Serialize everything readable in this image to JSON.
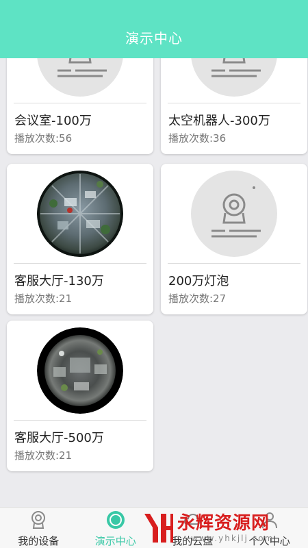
{
  "header": {
    "title": "演示中心"
  },
  "devices": [
    {
      "name": "会议室-100万",
      "plays": "播放次数:56",
      "thumb": "placeholder"
    },
    {
      "name": "太空机器人-300万",
      "plays": "播放次数:36",
      "thumb": "placeholder"
    },
    {
      "name": "客服大厅-130万",
      "plays": "播放次数:21",
      "thumb": "fisheye-office"
    },
    {
      "name": "200万灯泡",
      "plays": "播放次数:27",
      "thumb": "placeholder"
    },
    {
      "name": "客服大厅-500万",
      "plays": "播放次数:21",
      "thumb": "fisheye-office-dark"
    }
  ],
  "bottom_nav": {
    "items": [
      {
        "label": "我的设备",
        "icon": "camera-icon",
        "active": false
      },
      {
        "label": "演示中心",
        "icon": "demo-circle-icon",
        "active": true
      },
      {
        "label": "我的云盘",
        "icon": "cloud-icon",
        "active": false
      },
      {
        "label": "个人中心",
        "icon": "person-icon",
        "active": false
      }
    ]
  },
  "watermark": {
    "logo_text": "YH",
    "text": "永辉资源网",
    "url": "www.yhkjlj.com"
  },
  "colors": {
    "header": "#5ee3c4",
    "accent": "#39c8a6",
    "watermark": "#d81e1e"
  }
}
